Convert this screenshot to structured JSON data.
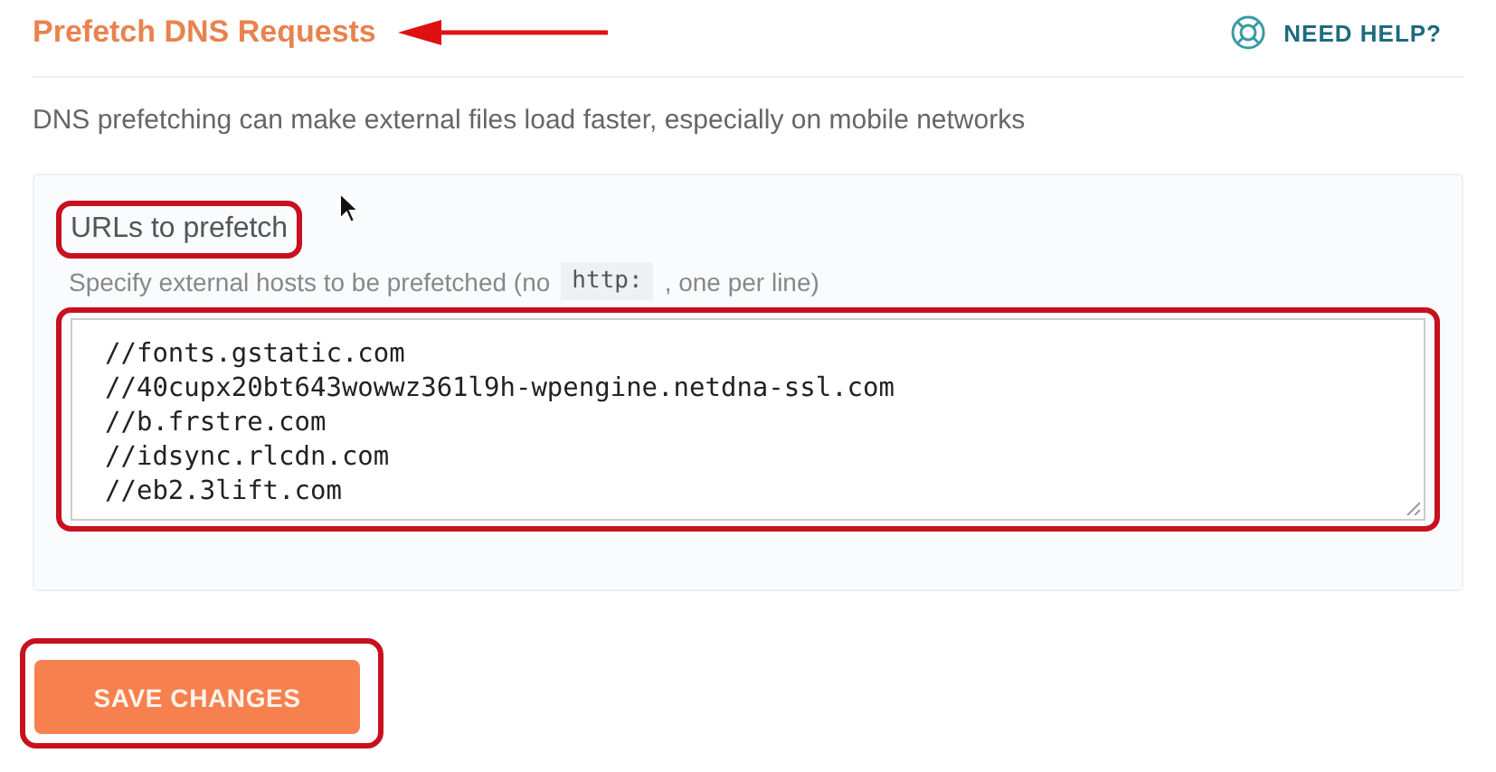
{
  "header": {
    "title": "Prefetch DNS Requests",
    "title_arrow": true,
    "help_link": "NEED HELP?"
  },
  "description": "DNS prefetching can make external files load faster, especially on mobile networks",
  "panel": {
    "label": "URLs to prefetch",
    "label_highlighted": true,
    "hint_before": "Specify external hosts to be prefetched (no",
    "hint_code": "http:",
    "hint_after": ", one per line)",
    "urls": [
      "//fonts.gstatic.com",
      "//40cupx20bt643wowwz361l9h-wpengine.netdna-ssl.com",
      "//b.frstre.com",
      "//idsync.rlcdn.com",
      "//eb2.3lift.com"
    ],
    "field_highlighted": true
  },
  "save_button": {
    "label": "SAVE CHANGES",
    "highlighted": true
  }
}
